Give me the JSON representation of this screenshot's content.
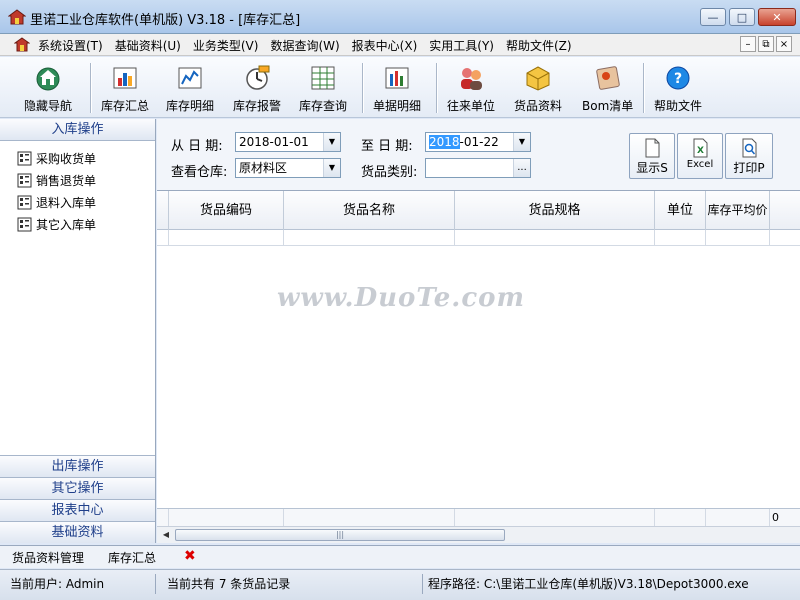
{
  "window": {
    "title": "里诺工业仓库软件(单机版) V3.18 - [库存汇总]",
    "minimize": "—",
    "maximize": "□",
    "close": "✕"
  },
  "menu": {
    "items": [
      "系统设置(T)",
      "基础资料(U)",
      "业务类型(V)",
      "数据查询(W)",
      "报表中心(X)",
      "实用工具(Y)",
      "帮助文件(Z)"
    ],
    "mdi_minimize": "–",
    "mdi_restore": "⧉",
    "mdi_close": "×"
  },
  "toolbar": {
    "buttons": [
      {
        "label": "隐藏导航",
        "icon": "home-navigation-icon"
      },
      {
        "label": "库存汇总",
        "icon": "inventory-summary-icon"
      },
      {
        "label": "库存明细",
        "icon": "inventory-detail-icon"
      },
      {
        "label": "库存报警",
        "icon": "inventory-alarm-icon"
      },
      {
        "label": "库存查询",
        "icon": "inventory-query-icon"
      },
      {
        "label": "单据明细",
        "icon": "document-detail-icon"
      },
      {
        "label": "往来单位",
        "icon": "partner-units-icon"
      },
      {
        "label": "货品资料",
        "icon": "goods-data-icon"
      },
      {
        "label": "Bom清单",
        "icon": "bom-list-icon"
      },
      {
        "label": "帮助文件",
        "icon": "help-icon"
      }
    ]
  },
  "sidebar": {
    "top_header": "入库操作",
    "items": [
      "采购收货单",
      "销售退货单",
      "退料入库单",
      "其它入库单"
    ],
    "bottom_headers": [
      "出库操作",
      "其它操作",
      "报表中心",
      "基础资料"
    ]
  },
  "filter": {
    "from_label": "从 日 期:",
    "from_value": "2018-01-01",
    "to_label": "至 日 期:",
    "to_value_selected": "2018",
    "to_value_rest": "-01-22",
    "warehouse_label": "查看仓库:",
    "warehouse_value": "原材料区",
    "category_label": "货品类别:",
    "category_value": "",
    "category_btn": "...",
    "show_btn": "显示S",
    "excel_btn": "Excel",
    "print_btn": "打印P"
  },
  "grid": {
    "columns": [
      "",
      "货品编码",
      "货品名称",
      "货品规格",
      "单位",
      "库存平均价",
      ""
    ],
    "footer_value": "0",
    "watermark": "www.DuoTe.com"
  },
  "tabs": {
    "items": [
      "货品资料管理",
      "库存汇总"
    ],
    "close": "✖"
  },
  "status": {
    "user": "当前用户: Admin",
    "records": "当前共有 7 条货品记录",
    "path": "程序路径: C:\\里诺工业仓库(单机版)V3.18\\Depot3000.exe"
  },
  "colors": {
    "accent": "#1f3f8a",
    "selection": "#3399ff",
    "close_red": "#c8422c"
  }
}
